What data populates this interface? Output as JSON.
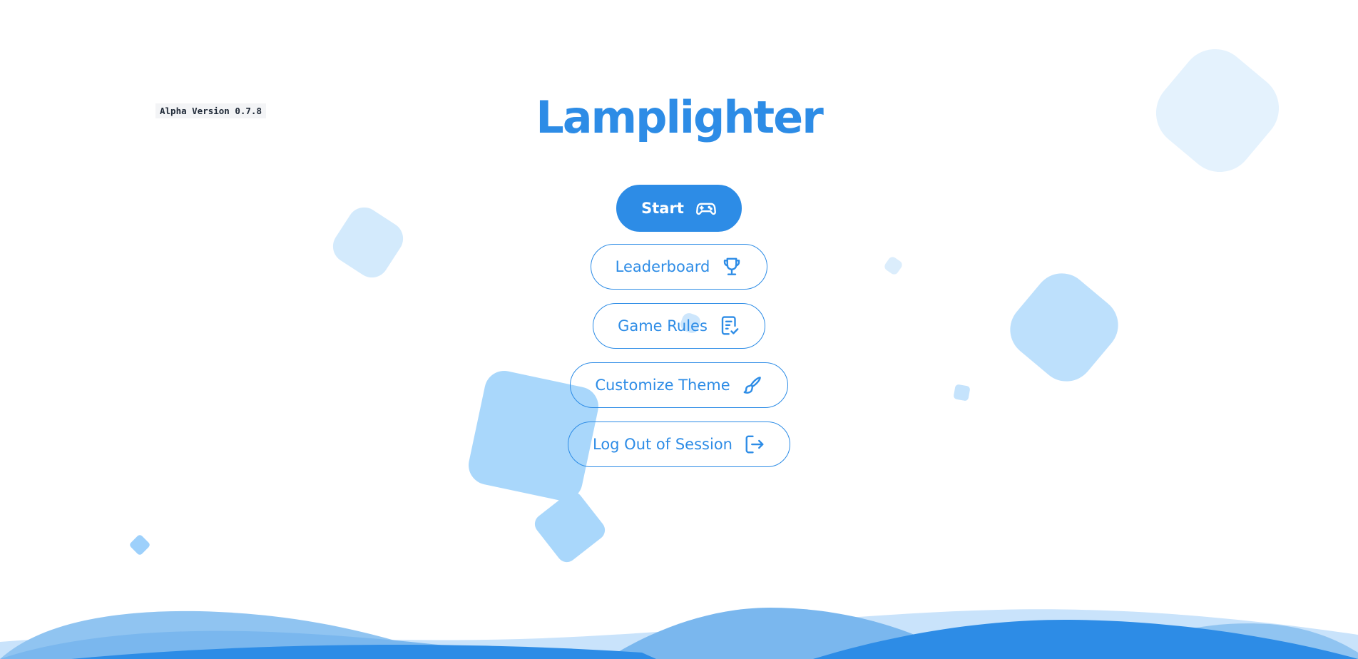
{
  "app": {
    "version_label": "Alpha Version 0.7.8",
    "title": "Lamplighter"
  },
  "menu": {
    "items": [
      {
        "label": "Start",
        "icon": "gamepad-icon",
        "variant": "primary"
      },
      {
        "label": "Leaderboard",
        "icon": "trophy-icon",
        "variant": "outline"
      },
      {
        "label": "Game Rules",
        "icon": "rules-checklist-icon",
        "variant": "outline"
      },
      {
        "label": "Customize Theme",
        "icon": "paintbrush-icon",
        "variant": "outline"
      },
      {
        "label": "Log Out of Session",
        "icon": "logout-icon",
        "variant": "outline"
      }
    ]
  },
  "theme": {
    "accent": "#2d8ce6",
    "background": "#ffffff",
    "shape_colors": [
      "#e4f2fd",
      "#d3eafc",
      "#bde0fc",
      "#a9d7fb",
      "#9dd0fb"
    ],
    "wave_colors": [
      "#c9e3fb",
      "#90c4f1",
      "#7ab7ee",
      "#2d8ce6"
    ]
  }
}
